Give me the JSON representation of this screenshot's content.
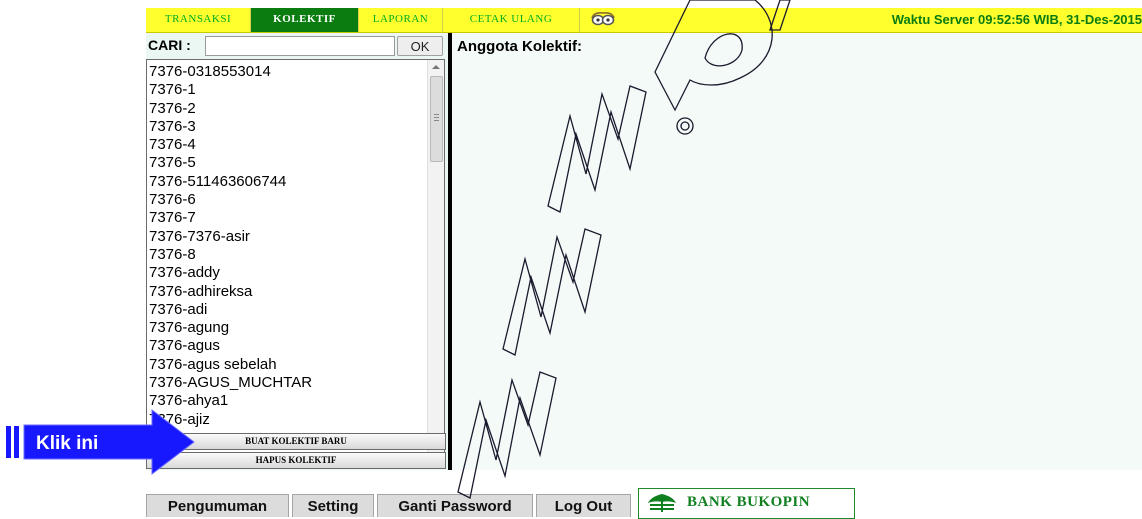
{
  "nav": {
    "tabs": [
      {
        "label": "TRANSAKSI",
        "active": false
      },
      {
        "label": "KOLEKTIF",
        "active": true
      },
      {
        "label": "LAPORAN",
        "active": false
      },
      {
        "label": "CETAK ULANG",
        "active": false
      }
    ],
    "icon": "glasses-icon",
    "server_time": "Waktu Server 09:52:56 WIB, 31-Des-2015"
  },
  "search": {
    "label": "CARI :",
    "value": "",
    "ok_label": "OK"
  },
  "list": {
    "items": [
      "7376-0318553014",
      "7376-1",
      "7376-2",
      "7376-3",
      "7376-4",
      "7376-5",
      "7376-511463606744",
      "7376-6",
      "7376-7",
      "7376-7376-asir",
      "7376-8",
      "7376-addy",
      "7376-adhireksa",
      "7376-adi",
      "7376-agung",
      "7376-agus",
      "7376-agus sebelah",
      "7376-AGUS_MUCHTAR",
      "7376-ahya1",
      "7376-ajiz"
    ]
  },
  "actions": {
    "create_label": "BUAT KOLEKTIF BARU",
    "delete_label": "HAPUS KOLEKTIF"
  },
  "detail": {
    "title": "Anggota Kolektif:"
  },
  "bottom": {
    "buttons": [
      "Pengumuman",
      "Setting",
      "Ganti Password",
      "Log Out"
    ],
    "bank_name": "BANK BUKOPIN"
  },
  "annotation": {
    "label": "Klik ini"
  },
  "colors": {
    "nav_bg": "#ffff2e",
    "nav_active_bg": "#0b7d10",
    "nav_text": "#00ad22",
    "panel_bg": "#eaf7f3",
    "arrow_blue": "#1818ff",
    "bank_green": "#0f7f1f"
  }
}
